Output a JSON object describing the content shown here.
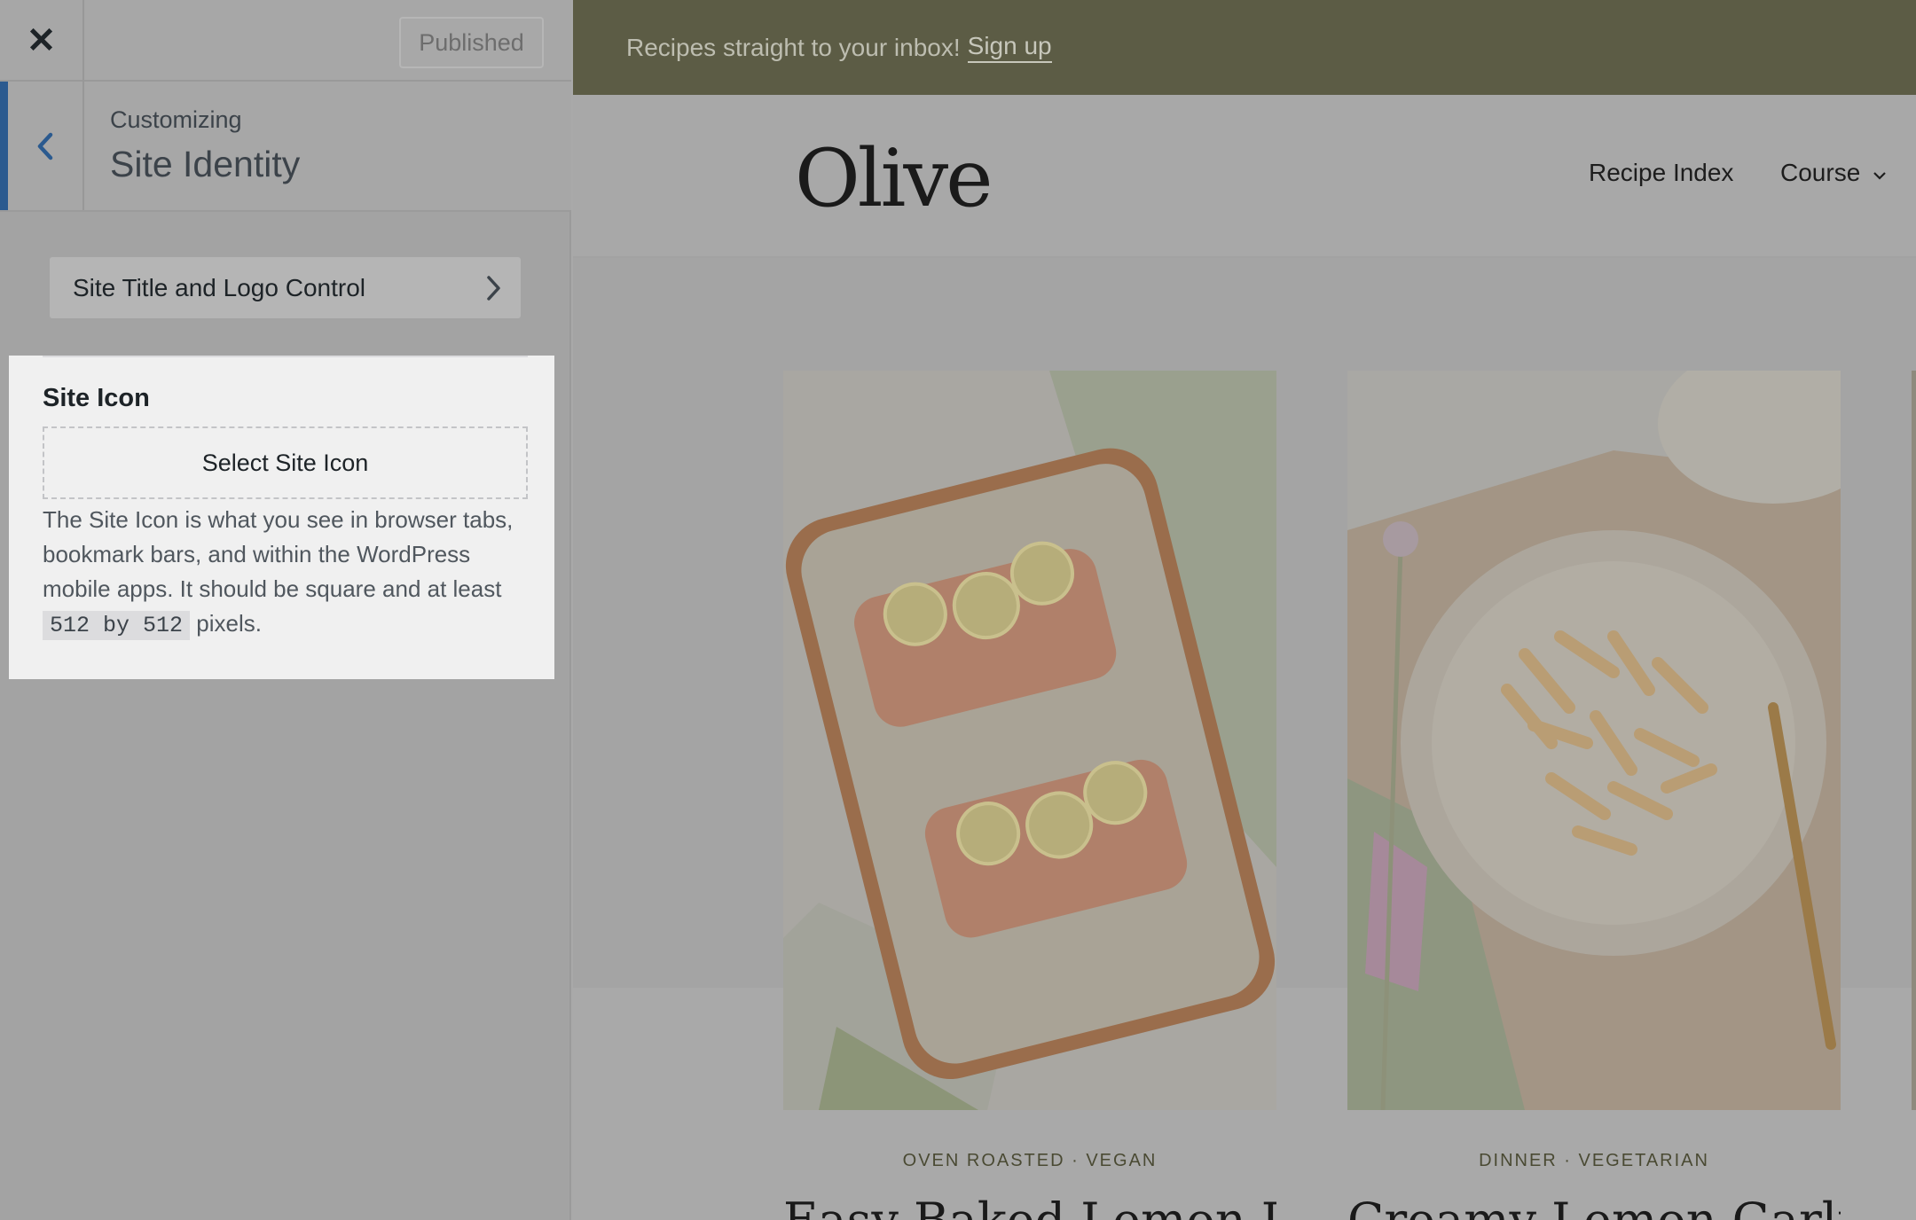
{
  "sidebar": {
    "header": {
      "close_icon": "close-icon",
      "publish_label": "Published"
    },
    "panel": {
      "subtitle": "Customizing",
      "title": "Site Identity"
    },
    "section_button": {
      "label": "Site Title and Logo Control"
    },
    "site_icon": {
      "title": "Site Icon",
      "select_label": "Select Site Icon",
      "description_1": "The Site Icon is what you see in browser tabs, bookmark bars, and within the WordPress mobile apps. It should be square and at least",
      "size_code": "512 by 512",
      "description_2": "pixels."
    }
  },
  "preview": {
    "topbar": {
      "text": "Recipes straight to your inbox!",
      "link": "Sign up"
    },
    "header": {
      "logo": "Olive",
      "nav": [
        {
          "label": "Recipe Index"
        },
        {
          "label": "Course"
        }
      ]
    },
    "cards": [
      {
        "meta": "OVEN ROASTED · VEGAN",
        "title": "Easy Baked Lemon Dill"
      },
      {
        "meta": "DINNER · VEGETARIAN",
        "title": "Creamy Lemon Garlic"
      }
    ]
  },
  "colors": {
    "accent": "#2b5a8f",
    "topbar": "#5c5c45"
  }
}
